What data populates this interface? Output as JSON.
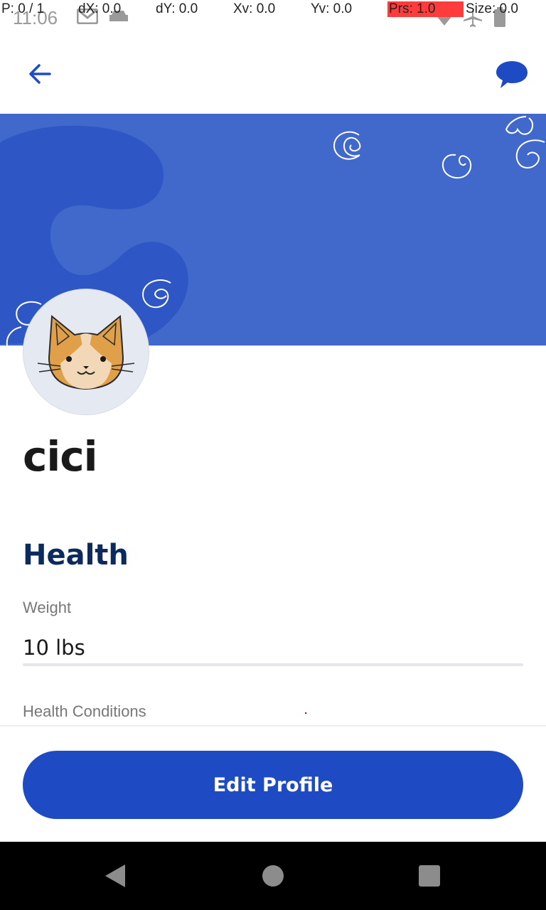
{
  "status_bar": {
    "time": "11:06"
  },
  "debug_overlay": {
    "pointer": "P: 0 / 1",
    "dx": "dX: 0.0",
    "dy": "dY: 0.0",
    "xv": "Xv: 0.0",
    "yv": "Yv: 0.0",
    "prs": "Prs: 1.0",
    "size": "Size: 0.0"
  },
  "app_bar": {
    "back_icon": "arrow-left-icon",
    "chat_icon": "chat-bubble-icon"
  },
  "profile": {
    "name": "cici",
    "avatar": "cat-face-avatar"
  },
  "health": {
    "section_title": "Health",
    "weight_label": "Weight",
    "weight_value": "10 lbs",
    "conditions_label": "Health Conditions"
  },
  "actions": {
    "edit_label": "Edit Profile"
  },
  "colors": {
    "banner": "#4169cb",
    "primary_button": "#1e4bc4",
    "heading": "#0c2a5e"
  }
}
